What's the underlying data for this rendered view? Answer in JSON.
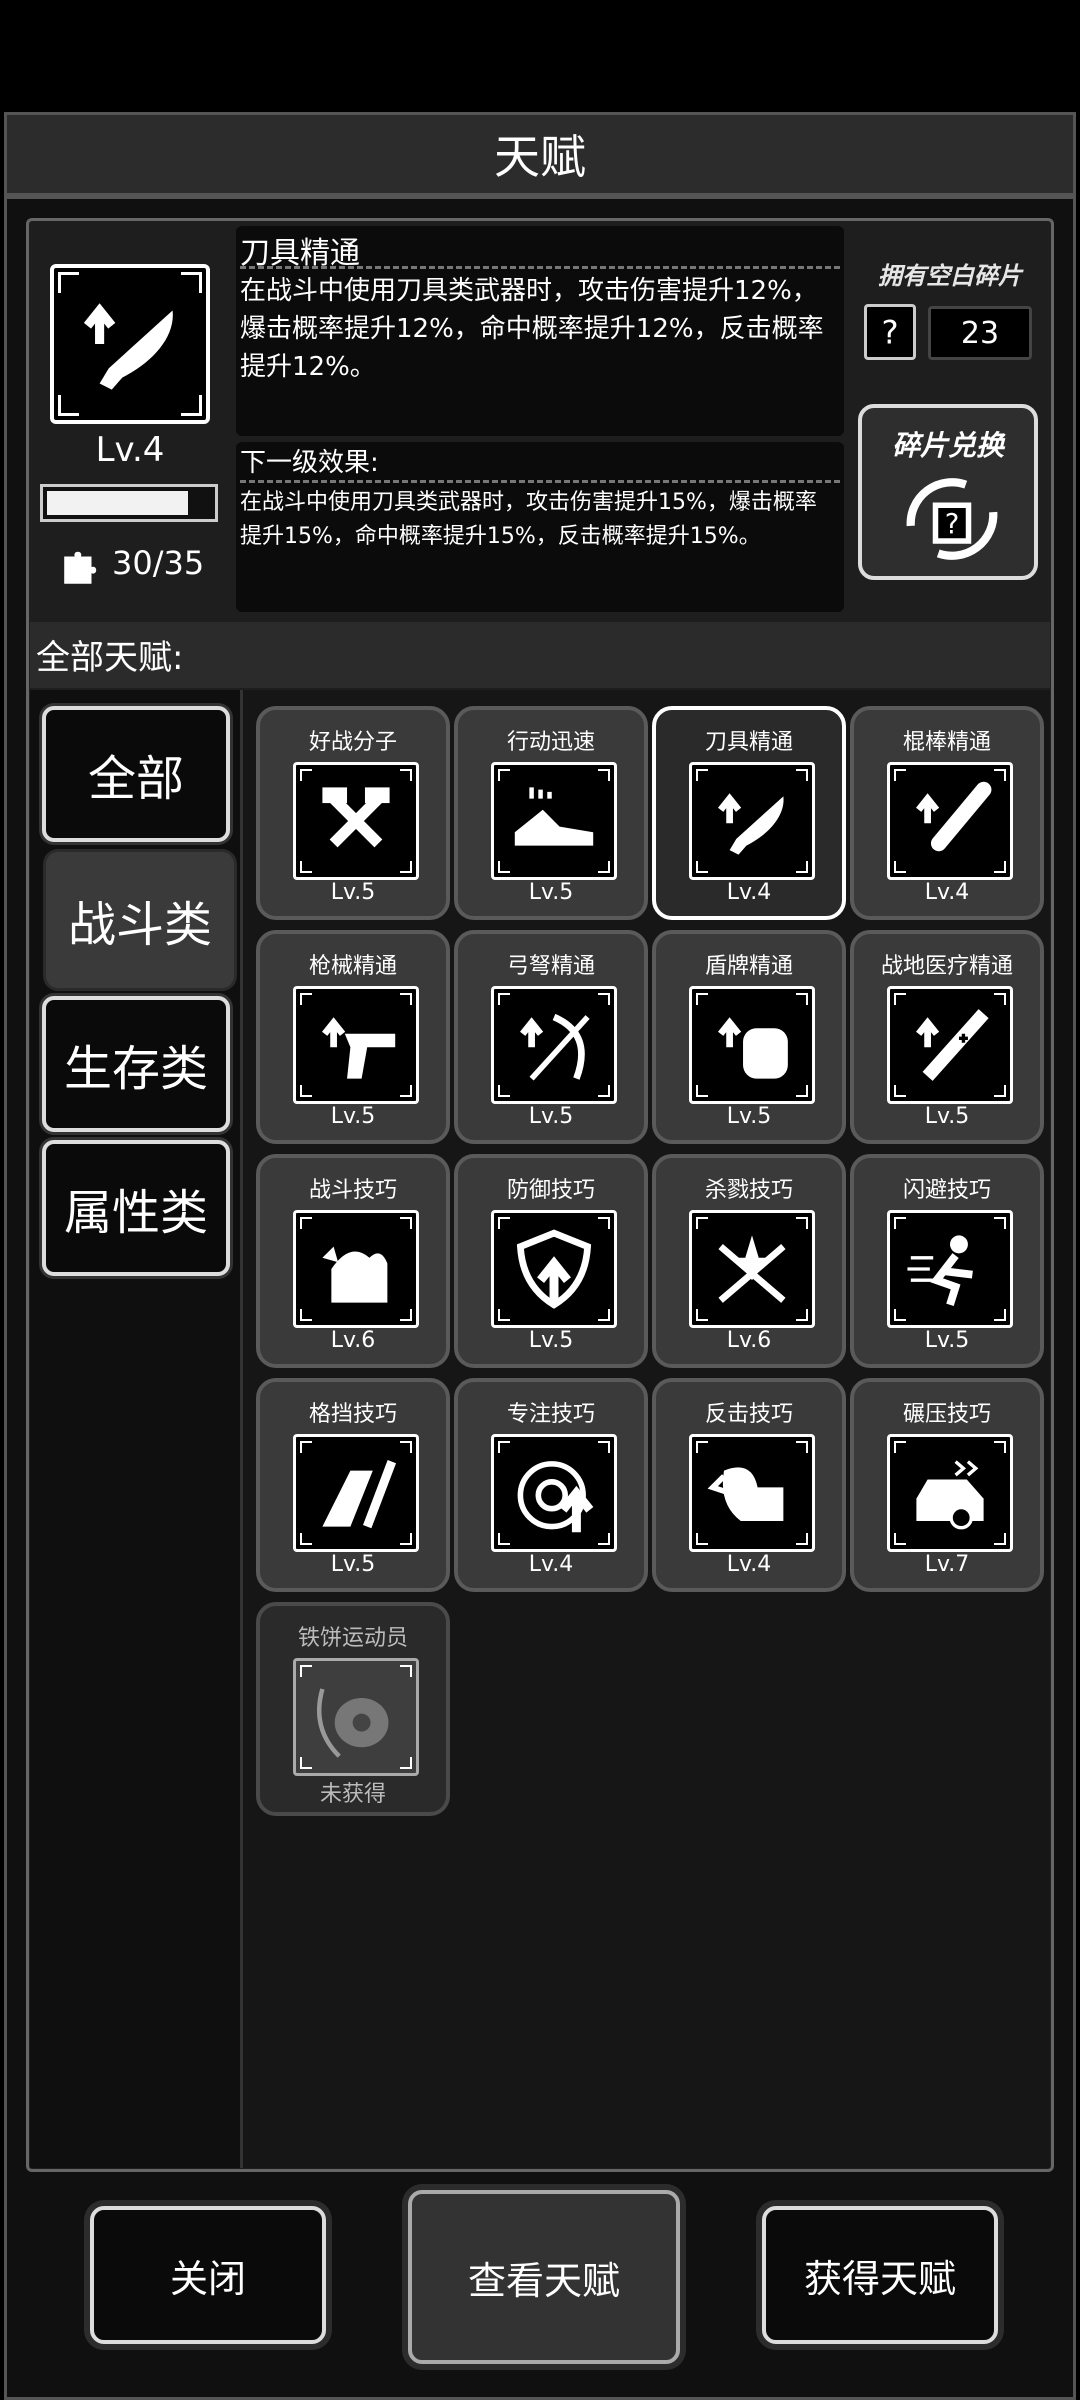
{
  "title": "天赋",
  "selected_talent": {
    "name": "刀具精通",
    "description": "在战斗中使用刀具类武器时，攻击伤害提升12%，爆击概率提升12%，命中概率提升12%，反击概率提升12%。",
    "next_level_title": "下一级效果:",
    "next_level_description": "在战斗中使用刀具类武器时，攻击伤害提升15%，爆击概率提升15%，命中概率提升15%，反击概率提升15%。",
    "level": "Lv.4",
    "exp_fraction": 0.86,
    "fragments": "30/35",
    "icon": "knife-upgrade-icon"
  },
  "blank_fragments": {
    "label": "拥有空白碎片",
    "count": "23",
    "icon": "question-fragment-icon"
  },
  "exchange_button": {
    "label": "碎片兑换",
    "icon": "fragment-exchange-icon"
  },
  "all_talents_label": "全部天赋:",
  "categories": [
    {
      "label": "全部",
      "active": false
    },
    {
      "label": "战斗类",
      "active": true
    },
    {
      "label": "生存类",
      "active": false
    },
    {
      "label": "属性类",
      "active": false
    }
  ],
  "talents": [
    {
      "name": "好战分子",
      "level": "Lv.5",
      "icon": "crossed-axes-icon"
    },
    {
      "name": "行动迅速",
      "level": "Lv.5",
      "icon": "running-shoe-icon"
    },
    {
      "name": "刀具精通",
      "level": "Lv.4",
      "icon": "knife-icon",
      "selected": true
    },
    {
      "name": "棍棒精通",
      "level": "Lv.4",
      "icon": "bat-icon"
    },
    {
      "name": "枪械精通",
      "level": "Lv.5",
      "icon": "pistol-icon"
    },
    {
      "name": "弓弩精通",
      "level": "Lv.5",
      "icon": "crossbow-icon"
    },
    {
      "name": "盾牌精通",
      "level": "Lv.5",
      "icon": "shield-block-icon"
    },
    {
      "name": "战地医疗精通",
      "level": "Lv.5",
      "icon": "syringe-icon"
    },
    {
      "name": "战斗技巧",
      "level": "Lv.6",
      "icon": "flexed-arm-icon"
    },
    {
      "name": "防御技巧",
      "level": "Lv.5",
      "icon": "shield-arrow-icon"
    },
    {
      "name": "杀戮技巧",
      "level": "Lv.6",
      "icon": "crossed-swords-icon"
    },
    {
      "name": "闪避技巧",
      "level": "Lv.5",
      "icon": "dodge-icon"
    },
    {
      "name": "格挡技巧",
      "level": "Lv.5",
      "icon": "parry-icon"
    },
    {
      "name": "专注技巧",
      "level": "Lv.4",
      "icon": "target-icon"
    },
    {
      "name": "反击技巧",
      "level": "Lv.4",
      "icon": "counter-hook-icon"
    },
    {
      "name": "碾压技巧",
      "level": "Lv.7",
      "icon": "car-crash-icon"
    },
    {
      "name": "铁饼运动员",
      "level": "未获得",
      "icon": "discus-icon",
      "locked": true
    }
  ],
  "buttons": {
    "close": "关闭",
    "view": "查看天赋",
    "get": "获得天赋"
  }
}
